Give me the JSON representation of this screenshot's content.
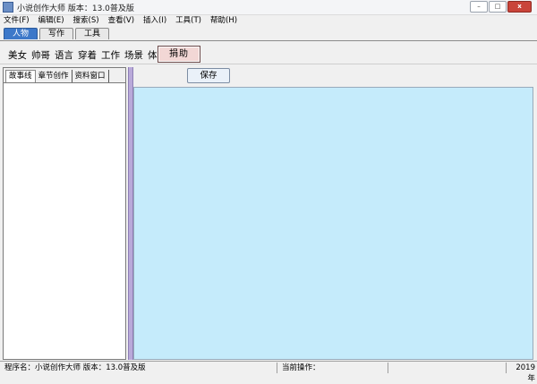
{
  "window": {
    "title": "小说创作大师 版本：13.0普及版",
    "controls": [
      "–",
      "□",
      "x"
    ]
  },
  "menu": [
    {
      "label": "文件(F)"
    },
    {
      "label": "编辑(E)"
    },
    {
      "label": "搜索(S)"
    },
    {
      "label": "查看(V)"
    },
    {
      "label": "插入(I)"
    },
    {
      "label": "工具(T)"
    },
    {
      "label": "帮助(H)"
    }
  ],
  "tabs": [
    {
      "label": "人物",
      "active": true
    },
    {
      "label": "写作",
      "active": false
    },
    {
      "label": "工具",
      "active": false
    }
  ],
  "categories": [
    "美女",
    "帅哥",
    "语言",
    "穿着",
    "工作",
    "场景",
    "体貌"
  ],
  "donate_label": "捐助",
  "left_tabs": [
    {
      "label": "故事线",
      "active": true
    },
    {
      "label": "章节创作",
      "active": false
    },
    {
      "label": "资料窗口",
      "active": false
    }
  ],
  "save_label": "保存",
  "editor": {
    "background": "#c5ebfb"
  },
  "status": {
    "program": "程序名：小说创作大师 版本：13.0普及版",
    "operation": "当前操作：",
    "year": "2019年"
  }
}
